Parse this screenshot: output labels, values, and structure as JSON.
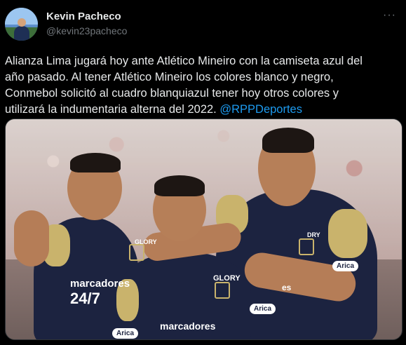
{
  "author": {
    "name": "Kevin Pacheco",
    "handle": "@kevin23pacheco"
  },
  "more_icon": "more-horizontal-icon",
  "tweet": {
    "lines": [
      "Alianza Lima jugará hoy ante Atlético Mineiro con la camiseta azul del",
      "año pasado. Al tener Atlético Mineiro los colores blanco y negro,",
      "Conmebol solicitó al cuadro blanquiazul tener hoy otros colores y",
      "utilizará la indumentaria alterna del 2022. "
    ],
    "mention": "@RPPDeportes"
  },
  "photo": {
    "sponsor_main": "marcadores",
    "sponsor_number": "24/7",
    "sponsor_bottom": "marcadores",
    "sponsor_small": "GLORY",
    "sponsor_right": "es",
    "badge_brand": "Arica",
    "logo_small": "DRY",
    "logo_small2": "GLORY"
  },
  "colors": {
    "background": "#000000",
    "text": "#e7e9ea",
    "secondary": "#71767b",
    "link": "#1d9bf0"
  }
}
